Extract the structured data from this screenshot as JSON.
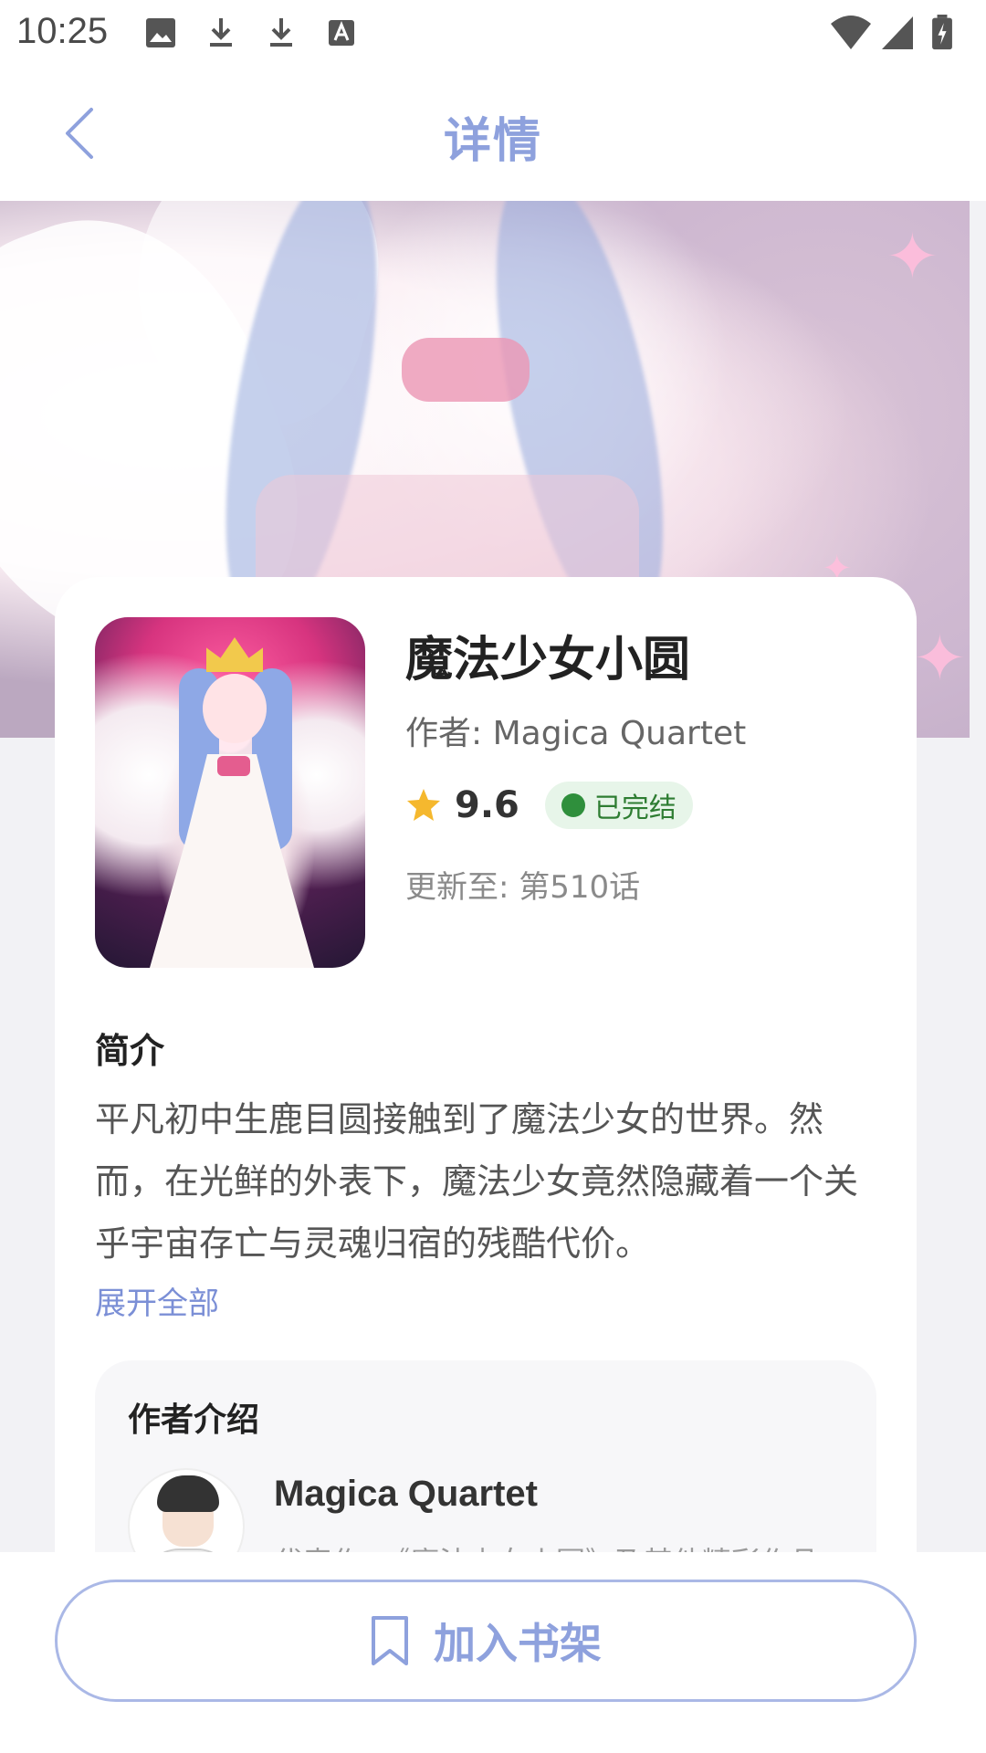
{
  "status_bar": {
    "time": "10:25",
    "icons": [
      "image-icon",
      "download-icon",
      "download-icon",
      "font-icon",
      "wifi-icon",
      "signal-icon",
      "battery-charging-icon"
    ]
  },
  "header": {
    "title": "详情",
    "back_icon": "chevron-left-icon"
  },
  "manga": {
    "title": "魔法少女小圆",
    "author": "作者: Magica Quartet",
    "rating": "9.6",
    "status": "已完结",
    "update": "更新至: 第510话"
  },
  "intro": {
    "heading": "简介",
    "text": "平凡初中生鹿目圆接触到了魔法少女的世界。然而，在光鲜的外表下，魔法少女竟然隐藏着一个关乎宇宙存亡与灵魂归宿的残酷代价。",
    "expand_label": "展开全部"
  },
  "author_section": {
    "heading": "作者介绍",
    "name": "Magica Quartet",
    "works": "代表作: 《魔法少女小圆》及其他精彩作品"
  },
  "bottom": {
    "shelf_label": "加入书架"
  },
  "colors": {
    "accent": "#8ea1dd",
    "badge_green": "#2e7d32",
    "star": "#f5b82e"
  }
}
